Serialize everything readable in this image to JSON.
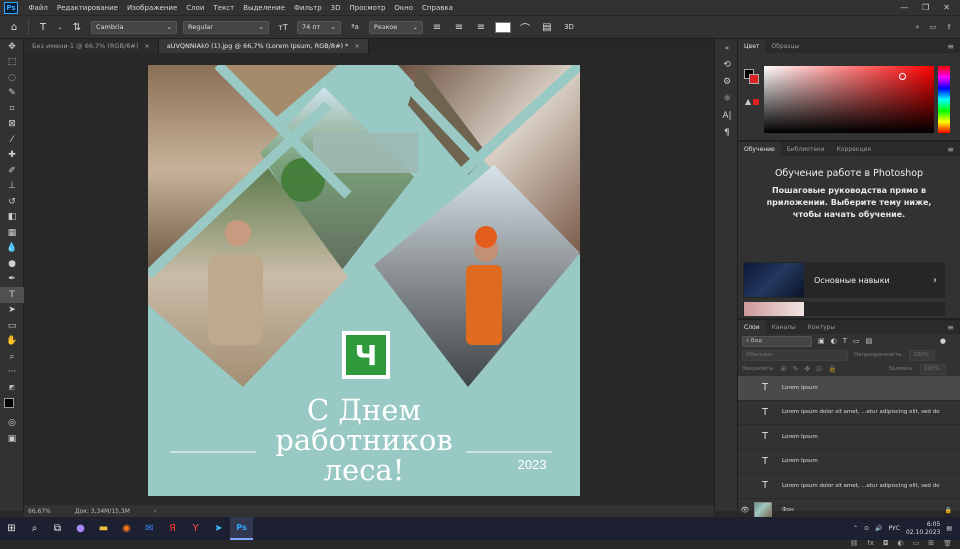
{
  "menu": [
    "Файл",
    "Редактирование",
    "Изображение",
    "Слои",
    "Текст",
    "Выделение",
    "Фильтр",
    "3D",
    "Просмотр",
    "Окно",
    "Справка"
  ],
  "app_logo": "Ps",
  "options": {
    "font_family": "Cambria",
    "font_style": "Regular",
    "font_size": "74 пт",
    "antialias": "Резкое",
    "text_color": "#ffffff"
  },
  "tabs": [
    {
      "label": "Без имени-1 @ 66,7% (RGB/8#)",
      "active": false
    },
    {
      "label": "aUVQNNIAk0 (1).jpg @ 66,7% (Lorem Ipsum, RGB/8#) *",
      "active": true
    }
  ],
  "artboard": {
    "title": "С Днем\nработников\nлеса!",
    "year": "2023",
    "logo_letter": "Ч",
    "bg_color": "#99c9c4"
  },
  "status": {
    "zoom": "66,67%",
    "doc": "Док: 3,34М/15,3М"
  },
  "color_panel": {
    "tabs": [
      "Цвет",
      "Образцы"
    ]
  },
  "learn_panel": {
    "tabs": [
      "Обучение",
      "Библиотеки",
      "Коррекция"
    ],
    "title": "Обучение работе в Photoshop",
    "subtitle": "Пошаговые руководства прямо в приложении. Выберите тему ниже, чтобы начать обучение.",
    "card_label": "Основные навыки"
  },
  "layers_panel": {
    "tabs": [
      "Слои",
      "Каналы",
      "Контуры"
    ],
    "filter": "Вид",
    "blend_mode": "Обычные",
    "opacity_label": "Непрозрачность:",
    "opacity_value": "100%",
    "lock_label": "Закрепить:",
    "fill_label": "Заливка:",
    "fill_value": "100%",
    "layers": [
      {
        "name": "Lorem Ipsum",
        "type": "text",
        "selected": true
      },
      {
        "name": "Lorem ipsum dolor sit amet, ...etur adipiscing elit, sed do",
        "type": "text",
        "selected": false
      },
      {
        "name": "Lorem Ipsum",
        "type": "text",
        "selected": false
      },
      {
        "name": "Lorem Ipsum",
        "type": "text",
        "selected": false
      },
      {
        "name": "Lorem ipsum dolor sit amet, ...etur adipiscing elit, sed do",
        "type": "text",
        "selected": false
      },
      {
        "name": "Фон",
        "type": "image",
        "selected": false
      }
    ]
  },
  "taskbar": {
    "lang": "РУС",
    "time": "6:05",
    "date": "02.10.2023"
  }
}
